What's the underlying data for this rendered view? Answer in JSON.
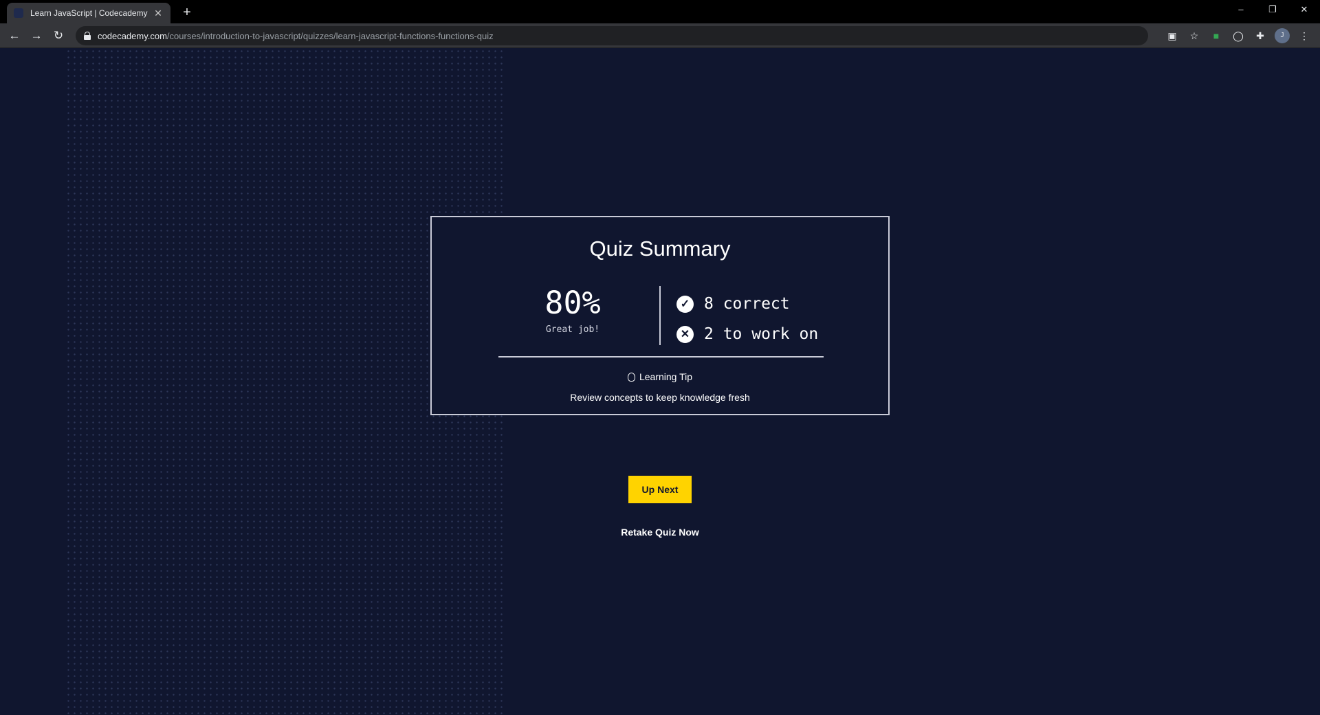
{
  "browser": {
    "tab_title": "Learn JavaScript | Codecademy",
    "tab_close": "✕",
    "new_tab": "+",
    "window_controls": [
      "–",
      "❐",
      "✕"
    ],
    "url_host": "codecademy.com",
    "url_path": "/courses/introduction-to-javascript/quizzes/learn-javascript-functions-functions-quiz",
    "profile_initial": "J"
  },
  "quiz": {
    "title": "Quiz Summary",
    "score": "80%",
    "score_message": "Great job!",
    "correct_text": "8 correct",
    "incorrect_text": "2 to work on",
    "tip_label": "Learning Tip",
    "tip_text": "Review concepts to keep knowledge fresh"
  },
  "actions": {
    "up_next": "Up Next",
    "retake": "Retake Quiz Now"
  },
  "colors": {
    "background": "#10162f",
    "accent": "#ffd300"
  }
}
